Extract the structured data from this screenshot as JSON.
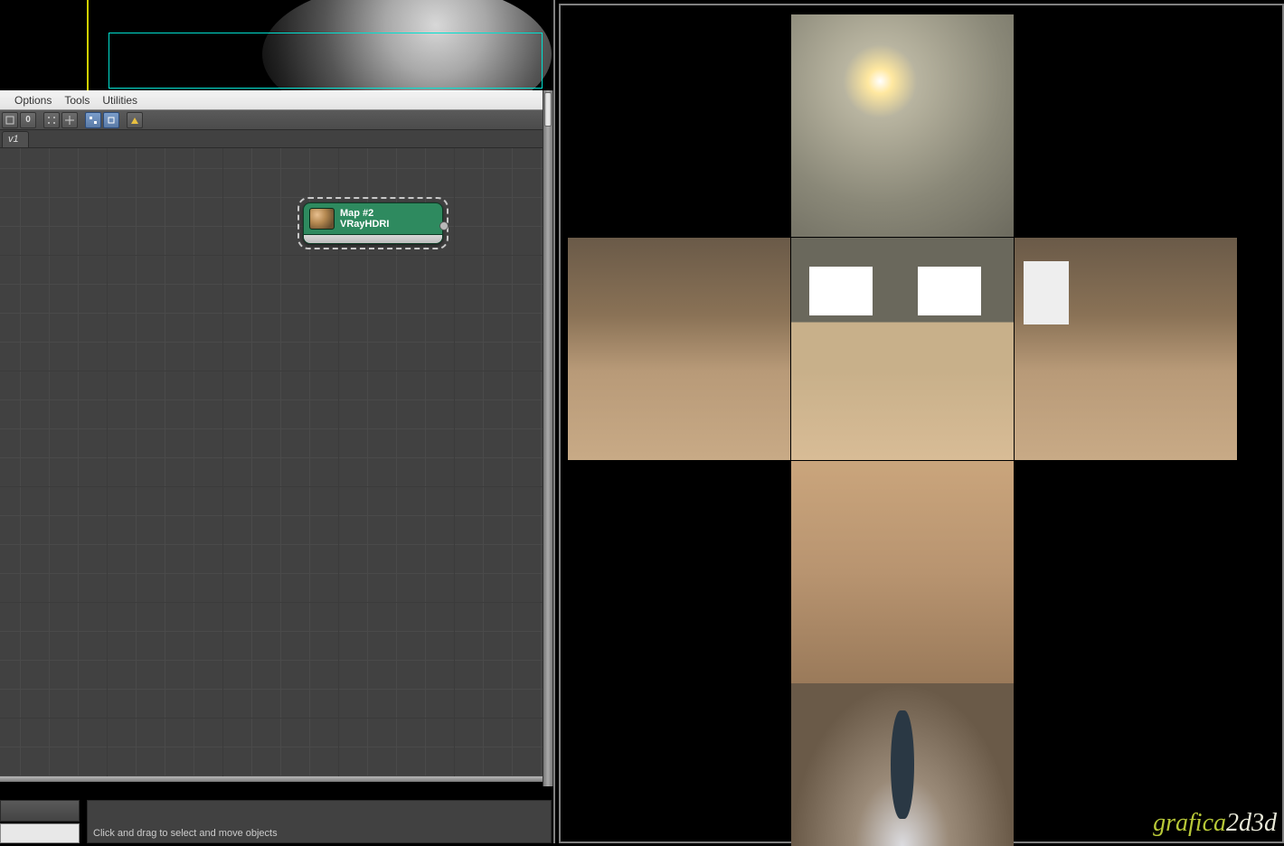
{
  "menu": {
    "options": "Options",
    "tools": "Tools",
    "utilities": "Utilities"
  },
  "toolbar": {
    "buttons": [
      "",
      "0",
      "",
      "",
      "",
      "",
      "",
      ""
    ]
  },
  "tabs": {
    "view1": "v1"
  },
  "node": {
    "title": "Map #2",
    "type": "VRayHDRI"
  },
  "status": {
    "hint": "Click and drag to select and move objects"
  },
  "watermark": {
    "a": "grafica",
    "b": "2d3d"
  }
}
